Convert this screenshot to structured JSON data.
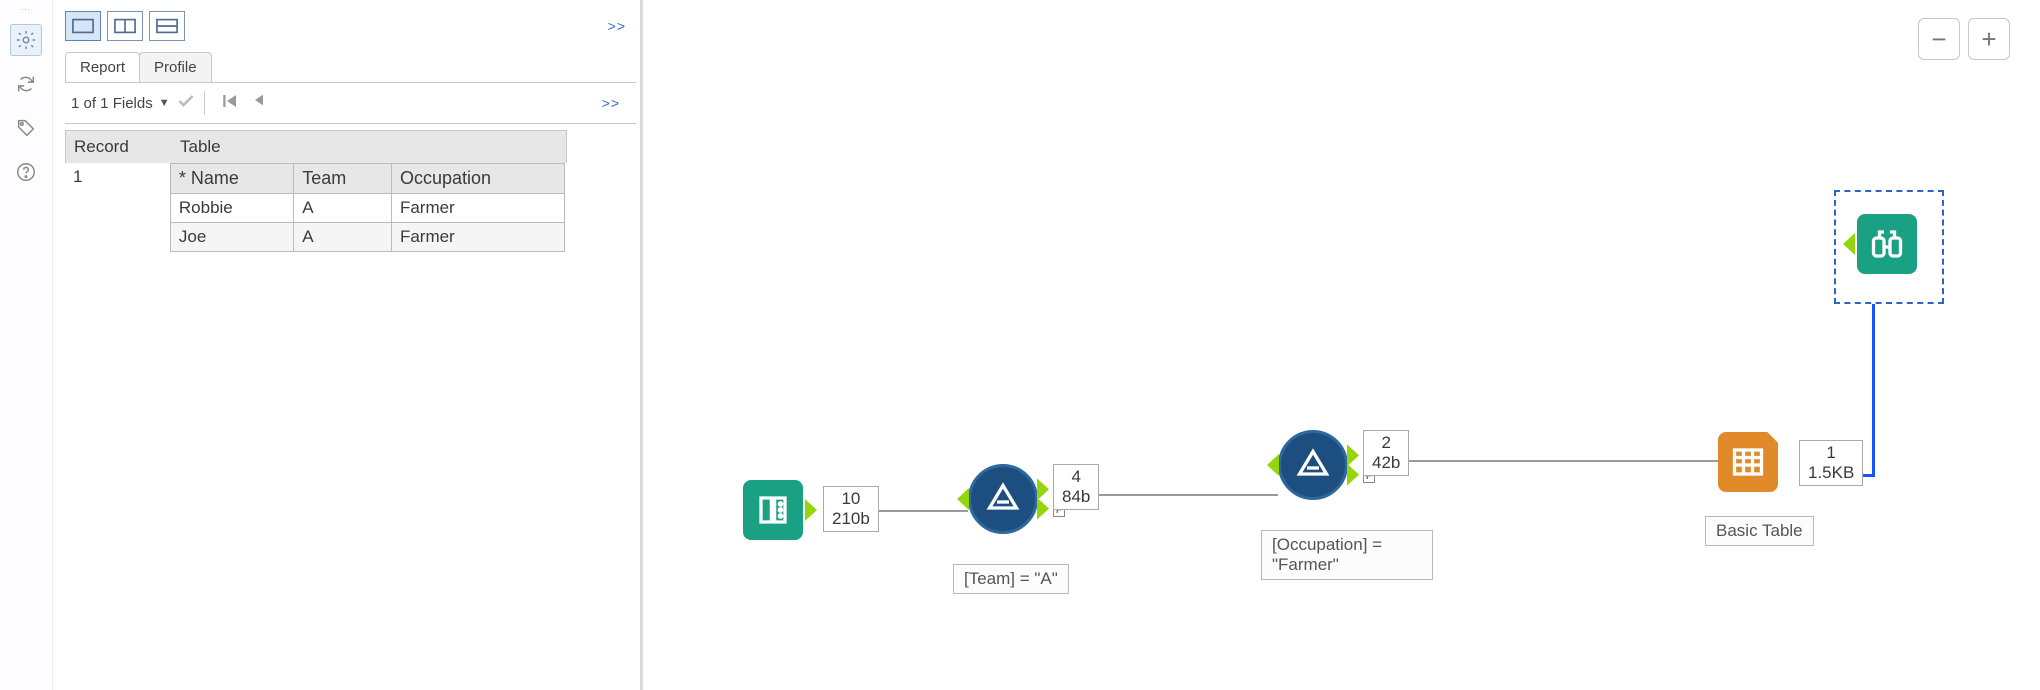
{
  "rail": {
    "icons": [
      "gear",
      "refresh",
      "tag",
      "help"
    ]
  },
  "panel": {
    "more_marker": ">>",
    "tabs": [
      {
        "label": "Report",
        "active": true
      },
      {
        "label": "Profile",
        "active": false
      }
    ],
    "fields_text": "1 of 1 Fields",
    "record_header": {
      "col1": "Record",
      "col2": "Table"
    },
    "record_index": "1",
    "inner_table": {
      "headers": [
        "* Name",
        "Team",
        "Occupation"
      ],
      "rows": [
        [
          "Robbie",
          "A",
          "Farmer"
        ],
        [
          "Joe",
          "A",
          "Farmer"
        ]
      ]
    }
  },
  "canvas": {
    "zoom_minus": "−",
    "zoom_plus": "+",
    "nodes": {
      "input": {
        "records": "10",
        "size": "210b"
      },
      "filter1": {
        "records": "4",
        "size": "84b",
        "caption": "[Team] = \"A\""
      },
      "filter2": {
        "records": "2",
        "size": "42b",
        "caption": "[Occupation] = \"Farmer\""
      },
      "table": {
        "records": "1",
        "size": "1.5KB",
        "caption": "Basic Table"
      },
      "browse": {}
    }
  }
}
